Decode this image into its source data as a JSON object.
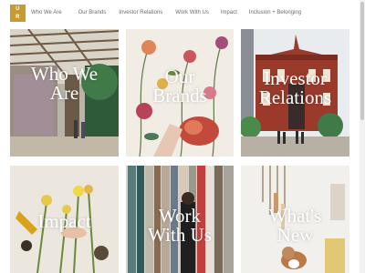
{
  "header": {
    "logo_lines": [
      "U",
      "R",
      "B",
      "N"
    ],
    "nav": [
      {
        "label": "Who We Are"
      },
      {
        "label": "Our Brands"
      },
      {
        "label": "Investor Relations"
      },
      {
        "label": "Work With Us"
      },
      {
        "label": "Impact"
      },
      {
        "label": "Inclusion + Belonging"
      }
    ]
  },
  "tiles": [
    {
      "label_line1": "Who We",
      "label_line2": "Are"
    },
    {
      "label_line1": "Our",
      "label_line2": "Brands"
    },
    {
      "label_line1": "Investor",
      "label_line2": "Relations"
    },
    {
      "label_line1": "Impact",
      "label_line2": ""
    },
    {
      "label_line1": "Work",
      "label_line2": "With Us"
    },
    {
      "label_line1": "What's",
      "label_line2": "New"
    }
  ],
  "colors": {
    "logo": "#c99a2e",
    "nav_text": "#6b6b6b",
    "tile_label": "#ffffff"
  }
}
